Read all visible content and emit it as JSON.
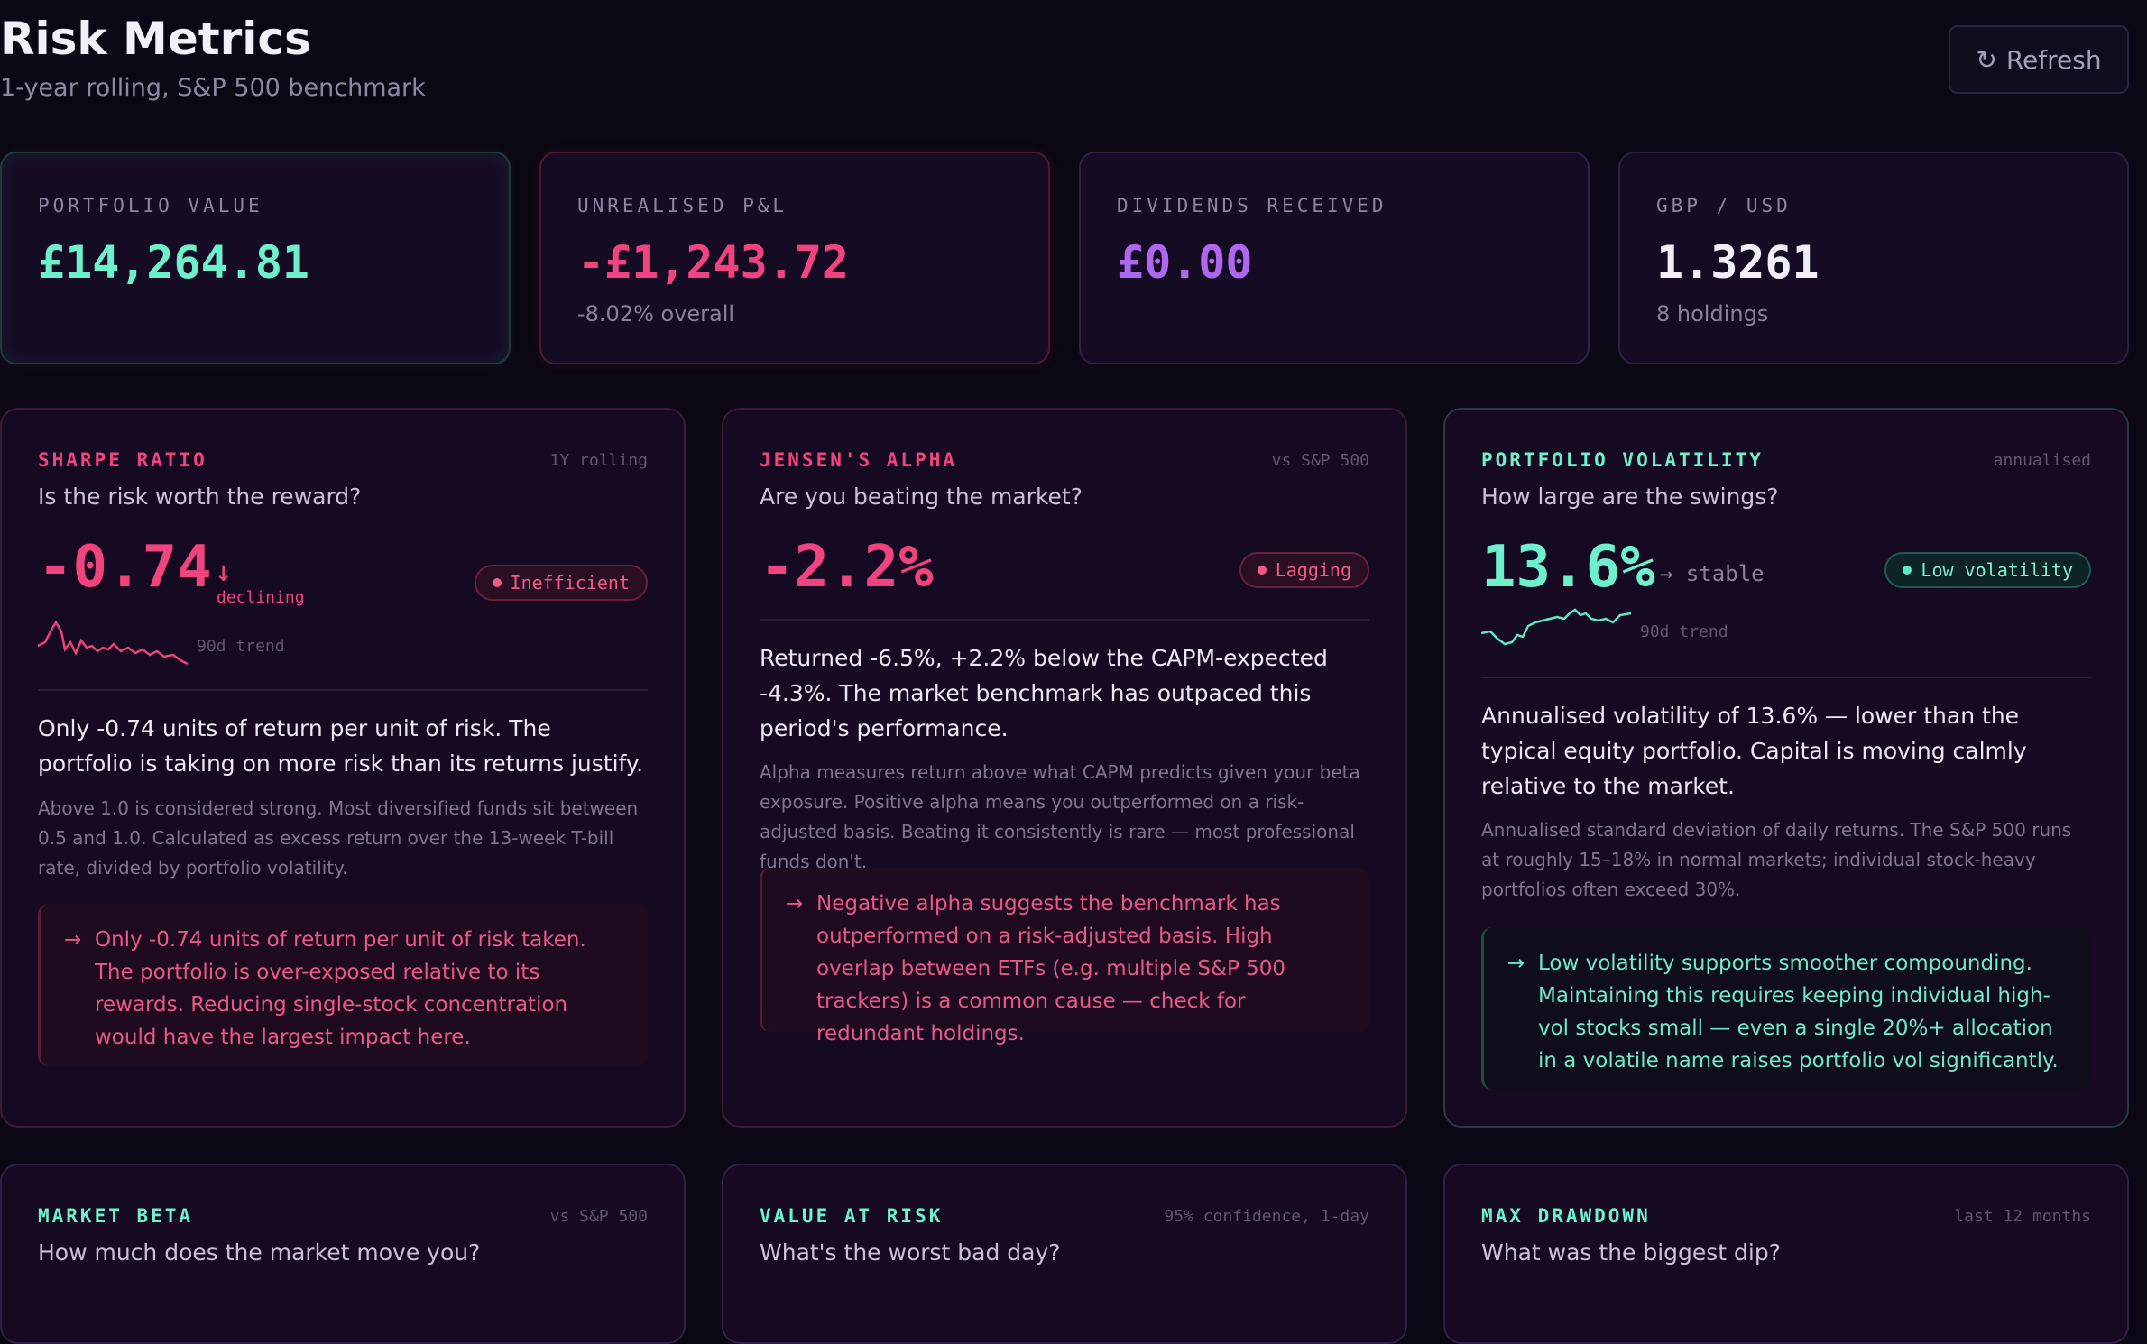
{
  "header": {
    "title": "Risk Metrics",
    "subtitle": "1-year rolling, S&P 500 benchmark",
    "refresh_icon": "↻",
    "refresh_label": "Refresh"
  },
  "stats": [
    {
      "label": "PORTFOLIO VALUE",
      "value": "£14,264.81",
      "sub": "",
      "color": "#6ff0cc"
    },
    {
      "label": "UNREALISED P&L",
      "value": "-£1,243.72",
      "sub": "-8.02% overall",
      "color": "#f0447e"
    },
    {
      "label": "DIVIDENDS RECEIVED",
      "value": "£0.00",
      "sub": "",
      "color": "#b067f0"
    },
    {
      "label": "GBP / USD",
      "value": "1.3261",
      "sub": "8 holdings",
      "color": "#f1eef8"
    }
  ],
  "cards": [
    {
      "kicker": "SHARPE RATIO",
      "tag": "1Y rolling",
      "question": "Is the risk worth the reward?",
      "value": "-0.74",
      "trend_arrow": "↓",
      "trend_label": "declining",
      "badge": "Inefficient",
      "spark_label": "90d trend",
      "desc": "Only -0.74 units of return per unit of risk. The portfolio is taking on more risk than its returns justify.",
      "note": "Above 1.0 is considered strong. Most diversified funds sit between 0.5 and 1.0. Calculated as excess return over the 13-week T-bill rate, divided by portfolio volatility.",
      "callout": "Only -0.74 units of return per unit of risk taken. The portfolio is over-exposed relative to its rewards. Reducing single-stock concentration would have the largest impact here."
    },
    {
      "kicker": "JENSEN'S ALPHA",
      "tag": "vs S&P 500",
      "question": "Are you beating the market?",
      "value": "-2.2%",
      "badge": "Lagging",
      "desc": "Returned -6.5%, +2.2% below the CAPM-expected -4.3%. The market benchmark has outpaced this period's performance.",
      "note": "Alpha measures return above what CAPM predicts given your beta exposure. Positive alpha means you outperformed on a risk-adjusted basis. Beating it consistently is rare — most professional funds don't.",
      "callout": "Negative alpha suggests the benchmark has outperformed on a risk-adjusted basis. High overlap between ETFs (e.g. multiple S&P 500 trackers) is a common cause — check for redundant holdings."
    },
    {
      "kicker": "PORTFOLIO VOLATILITY",
      "tag": "annualised",
      "question": "How large are the swings?",
      "value": "13.6%",
      "trend_label": "→ stable",
      "badge": "Low volatility",
      "spark_label": "90d trend",
      "desc": "Annualised volatility of 13.6% — lower than the typical equity portfolio. Capital is moving calmly relative to the market.",
      "note": "Annualised standard deviation of daily returns. The S&P 500 runs at roughly 15–18% in normal markets; individual stock-heavy portfolios often exceed 30%.",
      "callout": "Low volatility supports smoother compounding. Maintaining this requires keeping individual high-vol stocks small — even a single 20%+ allocation in a volatile name raises portfolio vol significantly."
    }
  ],
  "bottom_cards": [
    {
      "kicker": "MARKET BETA",
      "tag": "vs S&P 500",
      "question": "How much does the market move you?"
    },
    {
      "kicker": "VALUE AT RISK",
      "tag": "95% confidence, 1-day",
      "question": "What's the worst bad day?"
    },
    {
      "kicker": "MAX DRAWDOWN",
      "tag": "last 12 months",
      "question": "What was the biggest dip?"
    }
  ],
  "callout_arrow": "→",
  "colors": {
    "red": "#f0447e",
    "green": "#6ff0cc",
    "purple": "#b067f0"
  }
}
